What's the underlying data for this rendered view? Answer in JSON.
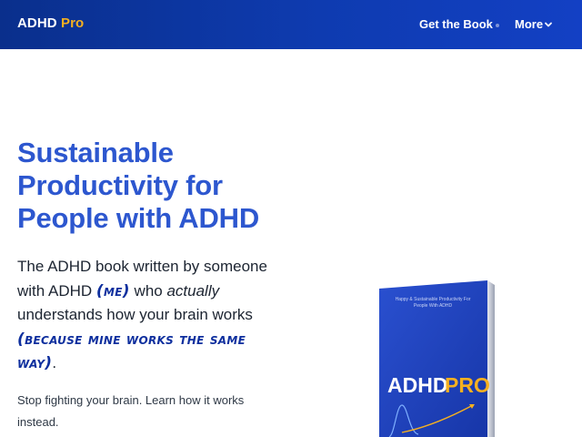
{
  "header": {
    "logo_text": "ADHD",
    "logo_accent": "Pro",
    "nav": {
      "get_book": "Get the Book",
      "more": "More"
    }
  },
  "hero": {
    "title_lines": [
      "Sustainable",
      "Productivity for",
      "People with ADHD"
    ],
    "lead": {
      "line1": "The ADHD book written by someone",
      "line2_pre": "with ADHD ",
      "line2_hand": "(me)",
      "line2_mid": " who ",
      "line2_em": "actually",
      "line3": "understands how your brain works",
      "line4_hand": "(because mine works the same",
      "line5_hand": "way)",
      "line5_end": "."
    },
    "sub_lines": [
      "Stop fighting your brain. Learn how it works",
      "instead."
    ]
  },
  "book": {
    "tagline_lines": [
      "Happy & Sustainable Productivity For",
      "People With ADHD"
    ],
    "title_main": "ADHD",
    "title_accent": "PRO"
  },
  "colors": {
    "header_bg": "#0e3bb0",
    "accent_yellow": "#f5b020",
    "title_blue": "#2d57cf",
    "hand_blue": "#0e2f9e",
    "book_blue": "#1f43c4"
  },
  "icons": {
    "more": "chevron-down-icon",
    "separator": "dot-icon"
  }
}
